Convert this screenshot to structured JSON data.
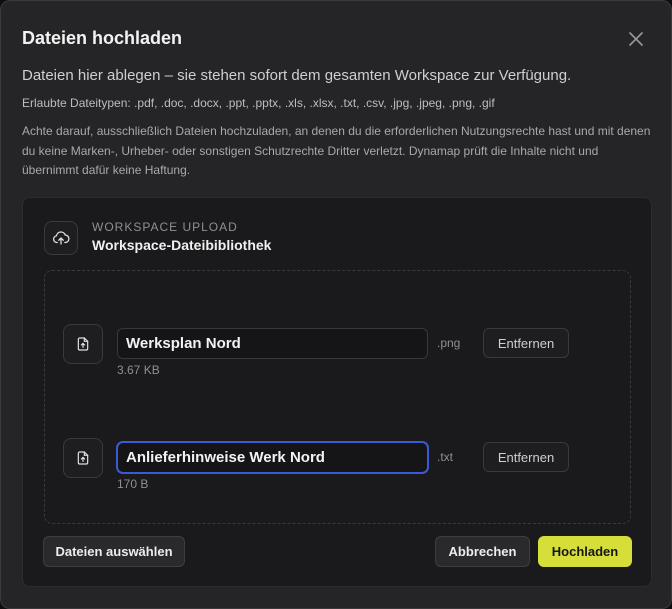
{
  "dialog": {
    "title": "Dateien hochladen",
    "lead": "Dateien hier ablegen – sie stehen sofort dem gesamten Workspace zur Verfügung.",
    "allowed_types": "Erlaubte Dateitypen: .pdf, .doc, .docx, .ppt, .pptx, .xls, .xlsx, .txt, .csv, .jpg, .jpeg, .png, .gif",
    "disclaimer": "Achte darauf, ausschließlich Dateien hochzuladen, an denen du die erforderlichen Nutzungsrechte hast und mit denen du keine Marken-, Urheber- oder sonstigen Schutzrechte Dritter verletzt. Dynamap prüft die Inhalte nicht und übernimmt dafür keine Haftung."
  },
  "workspace": {
    "kicker": "WORKSPACE UPLOAD",
    "title": "Workspace-Dateibibliothek"
  },
  "files": [
    {
      "name": "Werksplan Nord",
      "extension": ".png",
      "size": "3.67 KB",
      "remove_label": "Entfernen"
    },
    {
      "name": "Anlieferhinweise Werk Nord",
      "extension": ".txt",
      "size": "170 B",
      "remove_label": "Entfernen"
    }
  ],
  "footer": {
    "select_label": "Dateien auswählen",
    "cancel_label": "Abbrechen",
    "upload_label": "Hochladen"
  },
  "colors": {
    "accent": "#d6de3a",
    "focus": "#3b5bd6",
    "background": "#252527"
  }
}
